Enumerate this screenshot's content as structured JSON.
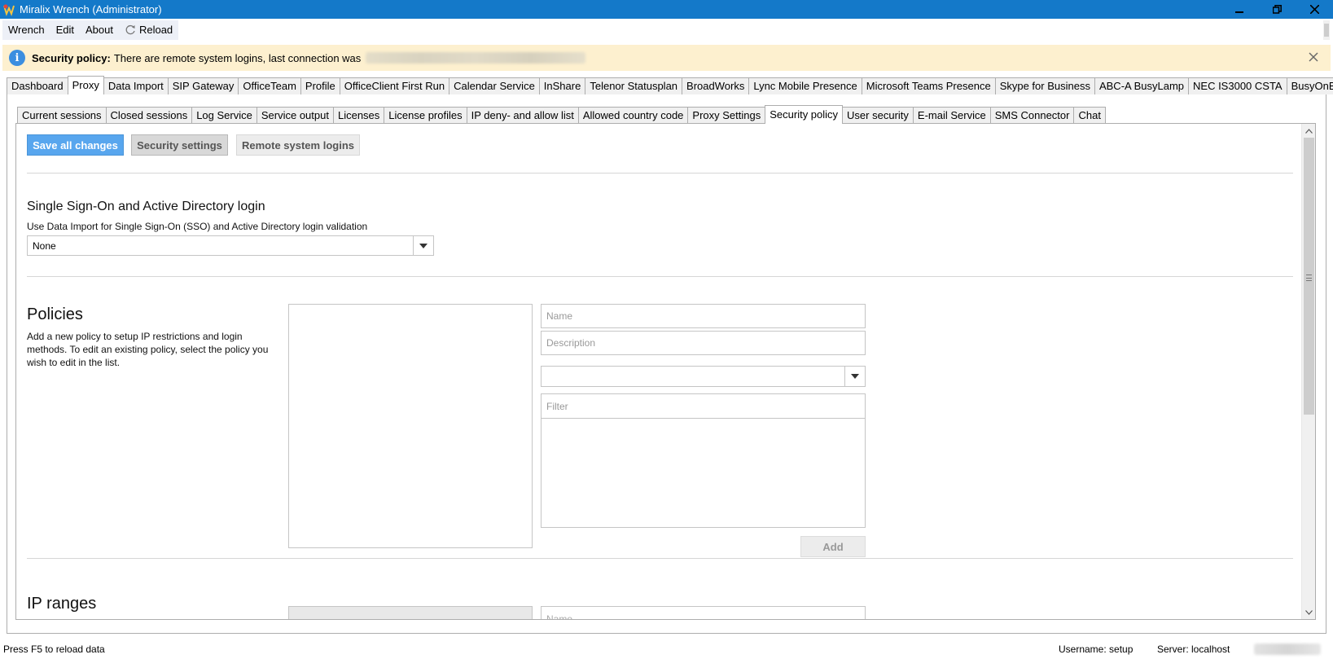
{
  "window": {
    "title": "Miralix Wrench (Administrator)",
    "minimize": "—",
    "restore": "❐",
    "close": "✕"
  },
  "menu": {
    "items": [
      "Wrench",
      "Edit",
      "About"
    ],
    "reload": "Reload"
  },
  "banner": {
    "strong": "Security policy:",
    "text": "There are remote system logins, last connection was",
    "close": "✕"
  },
  "main_tabs": [
    "Dashboard",
    "Proxy",
    "Data Import",
    "SIP Gateway",
    "OfficeTeam",
    "Profile",
    "OfficeClient First Run",
    "Calendar Service",
    "InShare",
    "Telenor Statusplan",
    "BroadWorks",
    "Lync Mobile Presence",
    "Microsoft Teams Presence",
    "Skype for Business",
    "ABC-A BusyLamp",
    "NEC IS3000 CSTA",
    "BusyOnBusy"
  ],
  "main_tab_active": "Proxy",
  "sub_tabs": [
    "Current sessions",
    "Closed sessions",
    "Log Service",
    "Service output",
    "Licenses",
    "License profiles",
    "IP deny- and allow list",
    "Allowed country code",
    "Proxy Settings",
    "Security policy",
    "User security",
    "E-mail Service",
    "SMS Connector",
    "Chat"
  ],
  "sub_tab_active": "Security policy",
  "toolbar": {
    "save": "Save all changes",
    "security_settings": "Security settings",
    "remote_logins": "Remote system logins"
  },
  "sso": {
    "heading": "Single Sign-On and Active Directory login",
    "description": "Use Data Import for Single Sign-On (SSO) and Active Directory login validation",
    "selected": "None"
  },
  "policies": {
    "heading": "Policies",
    "description": "Add a new policy to setup IP restrictions and login methods. To edit an existing policy, select the policy you wish to edit in the list.",
    "name_placeholder": "Name",
    "description_placeholder": "Description",
    "filter_placeholder": "Filter",
    "add": "Add"
  },
  "ip_ranges": {
    "heading": "IP ranges",
    "name_placeholder": "Name"
  },
  "status": {
    "hint": "Press F5 to reload data",
    "username": "Username: setup",
    "server": "Server: localhost"
  }
}
